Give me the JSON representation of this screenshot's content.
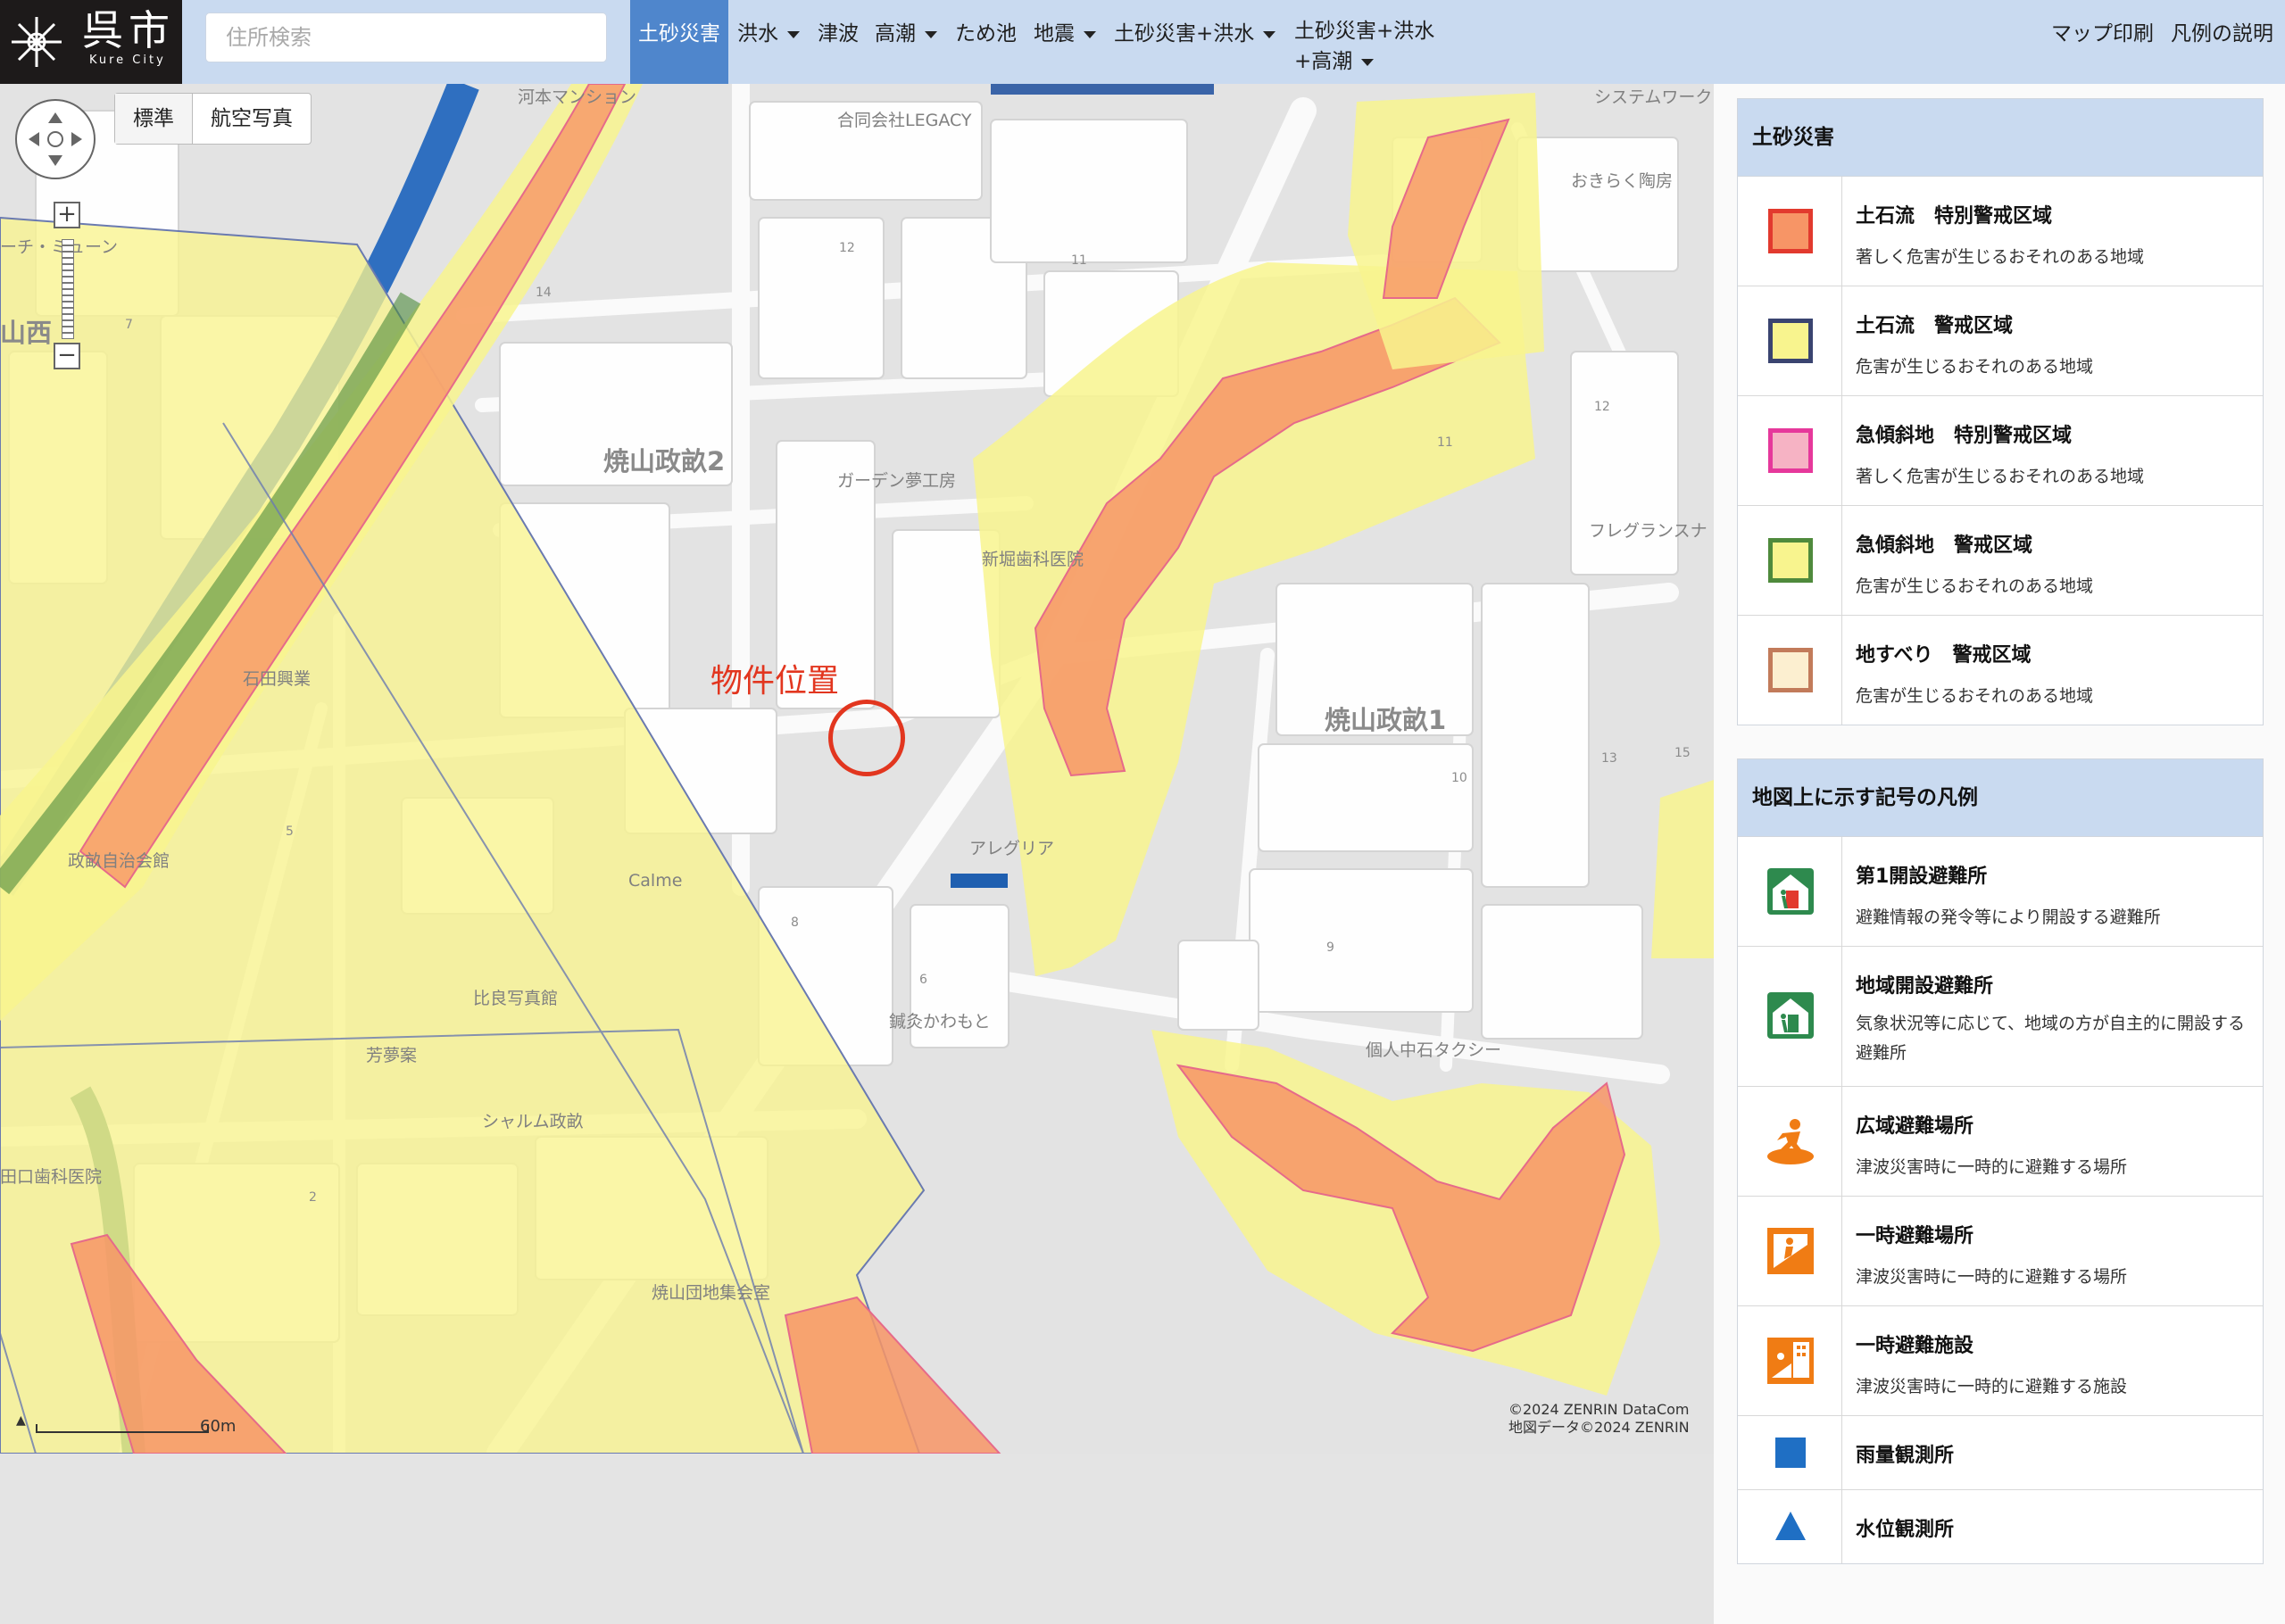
{
  "header": {
    "logo_text": "呉市",
    "logo_sub": "Kure City",
    "search_placeholder": "住所検索",
    "nav": [
      {
        "label": "土砂災害",
        "active": true
      },
      {
        "label": "洪水"
      },
      {
        "label": "津波"
      },
      {
        "label": "高潮"
      },
      {
        "label": "ため池"
      },
      {
        "label": "地震"
      },
      {
        "label": "土砂災害+洪水"
      },
      {
        "label": "土砂災害+洪水"
      },
      {
        "label": "+高潮"
      }
    ],
    "print_label": "マップ印刷",
    "legend_help_label": "凡例の説明"
  },
  "map": {
    "maptype_standard": "標準",
    "maptype_aerial": "航空写真",
    "property_label": "物件位置",
    "scale_label": "60m",
    "copyright_line1": "©2024 ZENRIN DataCom",
    "copyright_line2": "地図データ©2024 ZENRIN",
    "labels": {
      "legacy": "合同会社LEGACY",
      "okiraku": "おきらく陶房",
      "yakeyama2": "焼山政畝2",
      "yakeyama1": "焼山政畝1",
      "garden": "ガーデン夢工房",
      "shinbori": "新堀歯科医院",
      "fregrance": "フレグランスナ",
      "ishida": "石田興業",
      "allegria": "アレグリア",
      "masaune_hall": "政畝自治会館",
      "calme": "Calme",
      "hira": "比良写真館",
      "yoshin": "芳夢案",
      "charme": "シャルム政畝",
      "shinkyu": "鍼灸かわもと",
      "taxi": "個人中石タクシー",
      "yakeyama_danchi": "焼山団地集会室",
      "dental_left": "田口歯科医院",
      "archi": "ーチ・ミューン",
      "yamanishi": "山西",
      "system": "システムワーク",
      "river": "河本マンション",
      "n12a": "12",
      "n11a": "11",
      "n12b": "12",
      "n11b": "11",
      "n14": "14",
      "n10": "10",
      "n9": "9",
      "n8": "8",
      "n6": "6",
      "n2": "2",
      "n15": "15",
      "n13": "13",
      "n7": "7",
      "n5": "5"
    }
  },
  "legend_sediment": {
    "title": "土砂災害",
    "items": [
      {
        "title": "土石流　特別警戒区域",
        "desc": "著しく危害が生じるおそれのある地域",
        "fill": "#f79566",
        "border": "#e23a2e"
      },
      {
        "title": "土石流　警戒区域",
        "desc": "危害が生じるおそれのある地域",
        "fill": "#f8f48e",
        "border": "#3a4470"
      },
      {
        "title": "急傾斜地　特別警戒区域",
        "desc": "著しく危害が生じるおそれのある地域",
        "fill": "#f6b3c4",
        "border": "#e6389b"
      },
      {
        "title": "急傾斜地　警戒区域",
        "desc": "危害が生じるおそれのある地域",
        "fill": "#f8f48e",
        "border": "#4f8a3c"
      },
      {
        "title": "地すべり　警戒区域",
        "desc": "危害が生じるおそれのある地域",
        "fill": "#fcefd0",
        "border": "#c27b5a"
      }
    ]
  },
  "legend_symbols": {
    "title": "地図上に示す記号の凡例",
    "items": [
      {
        "title": "第1開設避難所",
        "desc": "避難情報の発令等により開設する避難所",
        "icon": "evacuation-shelter-first-icon"
      },
      {
        "title": "地域開設避難所",
        "desc": "気象状況等に応じて、地域の方が自主的に開設する避難所",
        "icon": "evacuation-shelter-local-icon"
      },
      {
        "title": "広域避難場所",
        "desc": "津波災害時に一時的に避難する場所",
        "icon": "wide-area-evacuation-icon"
      },
      {
        "title": "一時避難場所",
        "desc": "津波災害時に一時的に避難する場所",
        "icon": "temporary-evacuation-site-icon"
      },
      {
        "title": "一時避難施設",
        "desc": "津波災害時に一時的に避難する施設",
        "icon": "temporary-evacuation-building-icon"
      },
      {
        "title": "雨量観測所",
        "icon": "rain-gauge-icon"
      },
      {
        "title": "水位観測所",
        "icon": "water-level-station-icon"
      }
    ]
  },
  "colors": {
    "header_bg": "#c9daf0",
    "active_tab": "#4f86cc",
    "property_marker": "#e2361f",
    "hazard_yellow": "#f8f48e",
    "hazard_orange": "#f79566",
    "accent_blue": "#1f6fc4"
  }
}
